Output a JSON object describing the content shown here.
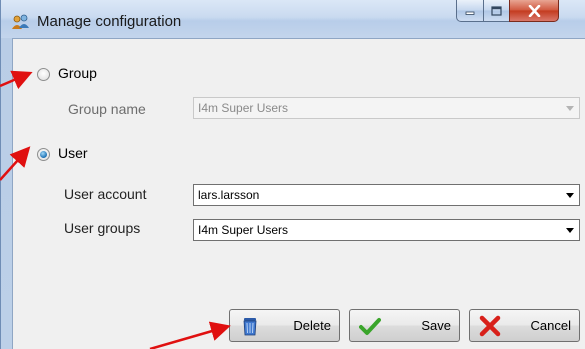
{
  "window": {
    "title": "Manage configuration",
    "icon": "users-icon",
    "controls": [
      "minimize-icon",
      "maximize-icon",
      "close-icon"
    ]
  },
  "mode": {
    "group_label": "Group",
    "user_label": "User",
    "selected": "User"
  },
  "group": {
    "name_label": "Group name",
    "name_value": "I4m Super Users",
    "enabled": false
  },
  "user": {
    "account_label": "User account",
    "account_value": "lars.larsson",
    "groups_label": "User groups",
    "groups_value": "I4m Super Users"
  },
  "buttons": {
    "delete": "Delete",
    "save": "Save",
    "cancel": "Cancel"
  },
  "colors": {
    "annotation_arrow": "#e01010",
    "save_check": "#3aa52b",
    "cancel_x": "#d8201a"
  }
}
